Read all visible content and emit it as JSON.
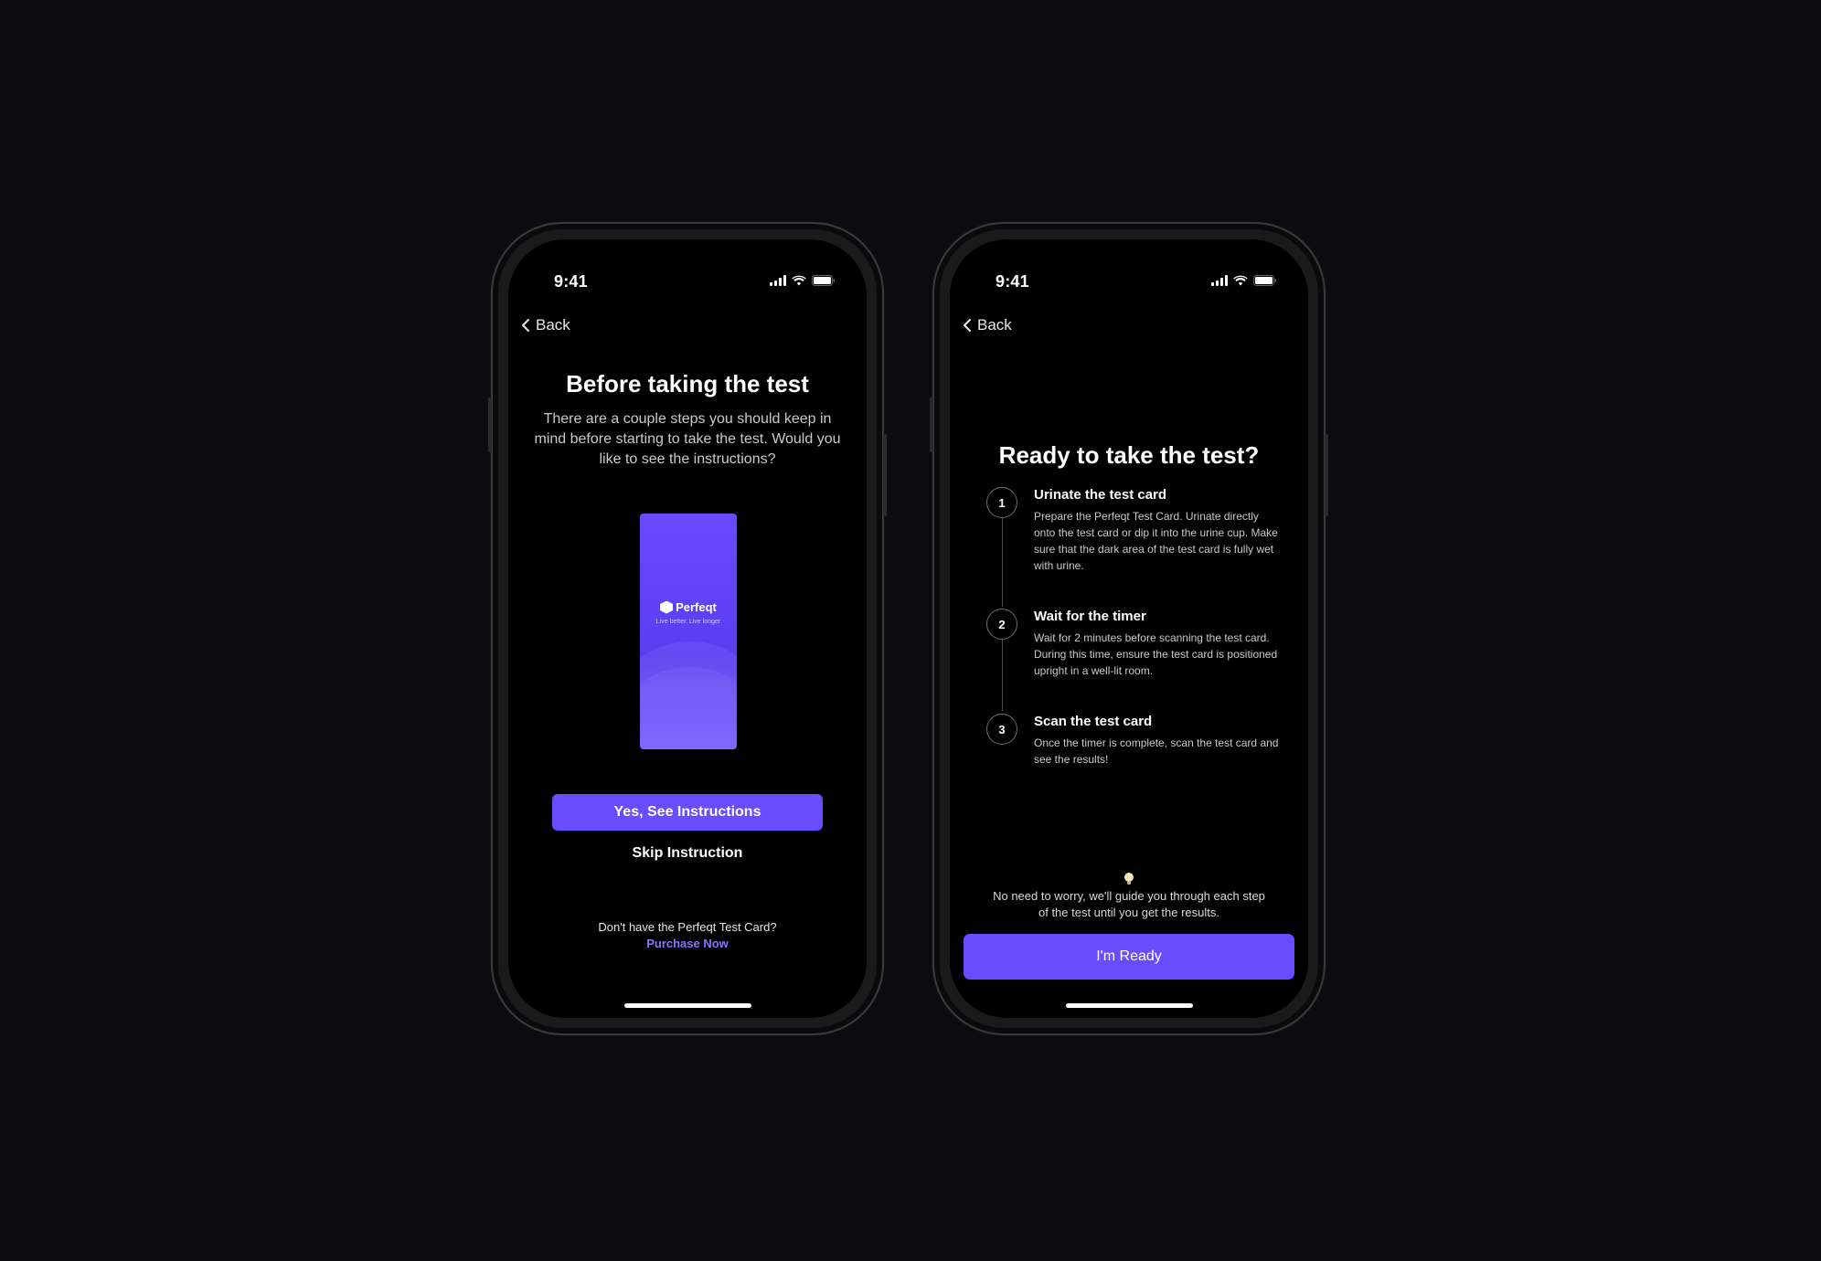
{
  "colors": {
    "background": "#0d0b12",
    "accent": "#6a4cff",
    "link": "#8a74ff"
  },
  "screen1": {
    "status_time": "9:41",
    "back_label": "Back",
    "title": "Before taking the test",
    "description": "There are a couple steps you should keep in mind before starting to take the test. Would you like to see the instructions?",
    "card": {
      "brand": "Perfeqt",
      "tagline": "Live better. Live longer"
    },
    "primary_button": "Yes, See Instructions",
    "skip_link": "Skip Instruction",
    "purchase_question": "Don't have the Perfeqt Test Card?",
    "purchase_link": "Purchase Now"
  },
  "screen2": {
    "status_time": "9:41",
    "back_label": "Back",
    "title": "Ready to take the test?",
    "steps": [
      {
        "number": "1",
        "title": "Urinate the test card",
        "description": "Prepare the Perfeqt Test Card. Urinate directly onto the test card or dip it into the urine cup. Make sure that the dark area of the test card is fully wet with urine."
      },
      {
        "number": "2",
        "title": "Wait for the timer",
        "description": "Wait for 2 minutes before scanning the test card. During this time, ensure the test card is positioned upright in a well-lit room."
      },
      {
        "number": "3",
        "title": "Scan the test card",
        "description": "Once the timer is complete, scan the test card and see the results!"
      }
    ],
    "hint_icon": "lightbulb-icon",
    "hint_text": "No need to worry, we'll guide you through each step of the test until you get the results.",
    "ready_button": "I'm Ready"
  }
}
